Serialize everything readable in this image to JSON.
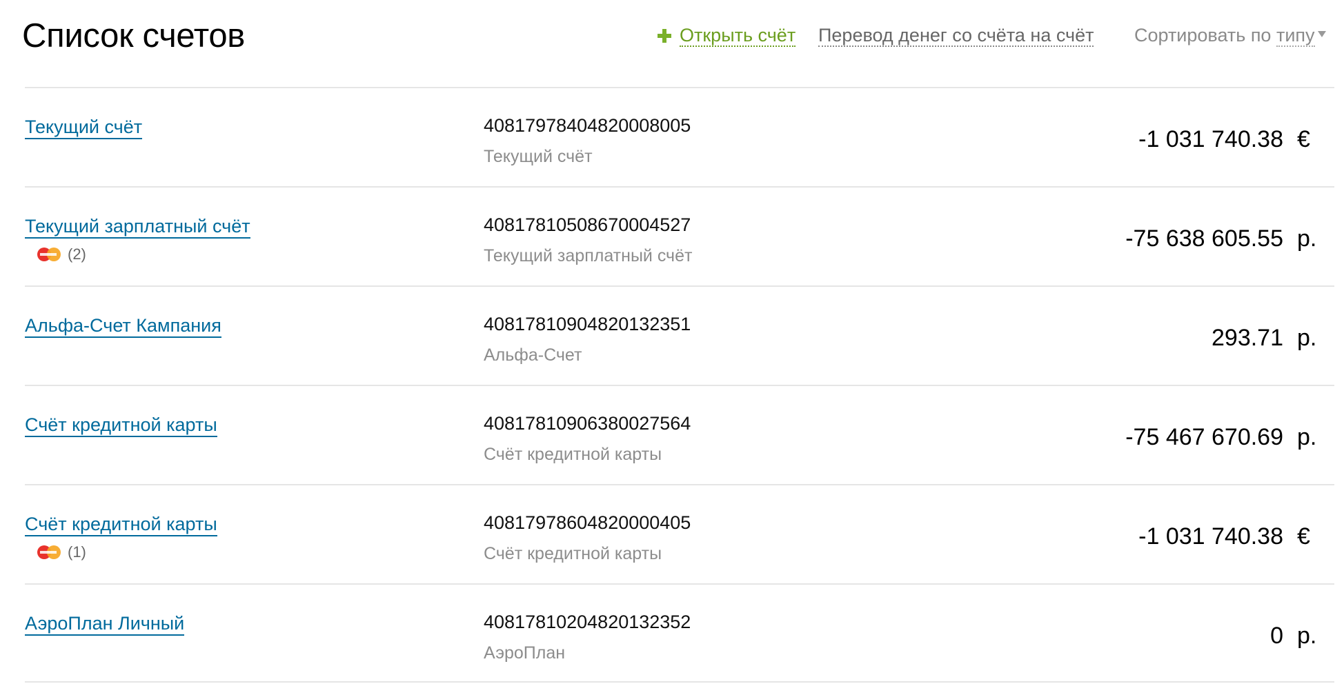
{
  "header": {
    "title": "Список счетов",
    "open_account_label": "Открыть счёт",
    "transfer_label": "Перевод денег со счёта на счёт",
    "sort_prefix": "Сортировать по",
    "sort_value": "типу"
  },
  "colors": {
    "link_blue": "#006a9c",
    "accent_green": "#6b9e1f",
    "muted_gray": "#8c8c8c"
  },
  "accounts": [
    {
      "name": "Текущий счёт",
      "number": "40817978404820008005",
      "type": "Текущий счёт",
      "amount": "-1 031 740.38",
      "currency": "€",
      "cards_count": ""
    },
    {
      "name": "Текущий зарплатный счёт",
      "number": "40817810508670004527",
      "type": "Текущий зарплатный счёт",
      "amount": "-75 638 605.55",
      "currency": "р.",
      "cards_count": "(2)"
    },
    {
      "name": "Альфа-Счет Кампания",
      "number": "40817810904820132351",
      "type": "Альфа-Счет",
      "amount": "293.71",
      "currency": "р.",
      "cards_count": ""
    },
    {
      "name": "Счёт кредитной карты",
      "number": "40817810906380027564",
      "type": "Счёт кредитной карты",
      "amount": "-75 467 670.69",
      "currency": "р.",
      "cards_count": ""
    },
    {
      "name": "Счёт кредитной карты",
      "number": "40817978604820000405",
      "type": "Счёт кредитной карты",
      "amount": "-1 031 740.38",
      "currency": "€",
      "cards_count": "(1)"
    },
    {
      "name": "АэроПлан Личный",
      "number": "40817810204820132352",
      "type": "АэроПлан",
      "amount": "0",
      "currency": "р.",
      "cards_count": ""
    }
  ]
}
